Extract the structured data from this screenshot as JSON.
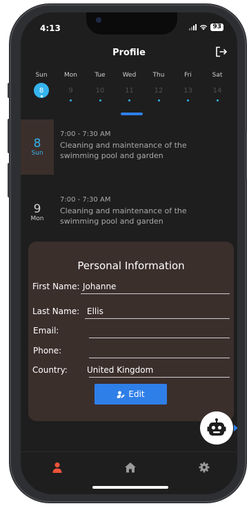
{
  "status_bar": {
    "time": "4:13",
    "battery": "93"
  },
  "header": {
    "title": "Profile",
    "logout_icon": "logout-icon"
  },
  "week": {
    "days": [
      {
        "name": "Sun",
        "date": "8",
        "selected": true
      },
      {
        "name": "Mon",
        "date": "9"
      },
      {
        "name": "Tue",
        "date": "10"
      },
      {
        "name": "Wed",
        "date": "11"
      },
      {
        "name": "Thu",
        "date": "12"
      },
      {
        "name": "Fri",
        "date": "13"
      },
      {
        "name": "Sat",
        "date": "14"
      }
    ]
  },
  "events": [
    {
      "day_num": "8",
      "day_name": "Sun",
      "time": "7:00 - 7:30 AM",
      "description": "Cleaning and maintenance of the swimming pool and garden"
    },
    {
      "day_num": "9",
      "day_name": "Mon",
      "time": "7:00 - 7:30 AM",
      "description": "Cleaning and maintenance of the swimming pool and garden"
    }
  ],
  "personal_info": {
    "title": "Personal Information",
    "fields": [
      {
        "label": "First Name:",
        "value": "Johanne"
      },
      {
        "label": "Last Name:",
        "value": "Ellis"
      },
      {
        "label": "Email:",
        "value": ""
      },
      {
        "label": "Phone:",
        "value": ""
      },
      {
        "label": "Country:",
        "value": "United Kingdom"
      }
    ],
    "edit_label": "Edit"
  },
  "tabbar": {
    "items": [
      "profile-icon",
      "home-icon",
      "settings-icon"
    ]
  },
  "colors": {
    "accent": "#35b4ee",
    "button": "#2f7fe8",
    "card": "#3b2f2c",
    "active_tab": "#f0533a",
    "background": "#1e1e1e"
  }
}
